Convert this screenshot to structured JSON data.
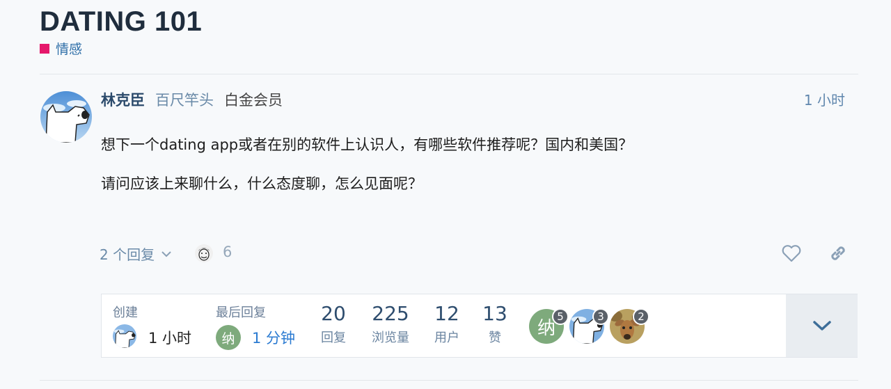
{
  "topic": {
    "title": "DATING 101",
    "category": {
      "label": "情感",
      "color": "#e5186b"
    }
  },
  "post": {
    "username": "林克臣",
    "full_name": "百尺竿头",
    "flair": "白金会员",
    "time": "1 小时",
    "paragraphs": [
      "想下一个dating app或者在别的软件上认识人，有哪些软件推荐呢？国内和美国？",
      "请问应该上来聊什么，什么态度聊，怎么见面呢？"
    ],
    "replies_toggle": "2 个回复",
    "reader_count": "6",
    "icons": {
      "like": "heart-icon",
      "share": "link-icon",
      "expand": "chevron-down-icon"
    }
  },
  "summary": {
    "created_label": "创建",
    "created_time": "1 小时",
    "last_reply_label": "最后回复",
    "last_reply_avatar_char": "纳",
    "last_reply_time": "1 分钟",
    "stats": [
      {
        "value": "20",
        "label": "回复"
      },
      {
        "value": "225",
        "label": "浏览量"
      },
      {
        "value": "12",
        "label": "用户"
      },
      {
        "value": "13",
        "label": "赞"
      }
    ],
    "participants": [
      {
        "avatar_char": "纳",
        "count": "5"
      },
      {
        "avatar_char": "",
        "count": "3"
      },
      {
        "avatar_char": "",
        "count": "2"
      }
    ]
  },
  "colors": {
    "accent": "#2a7ad1",
    "category": "#e5186b",
    "na_avatar": "#7eaa7c"
  }
}
